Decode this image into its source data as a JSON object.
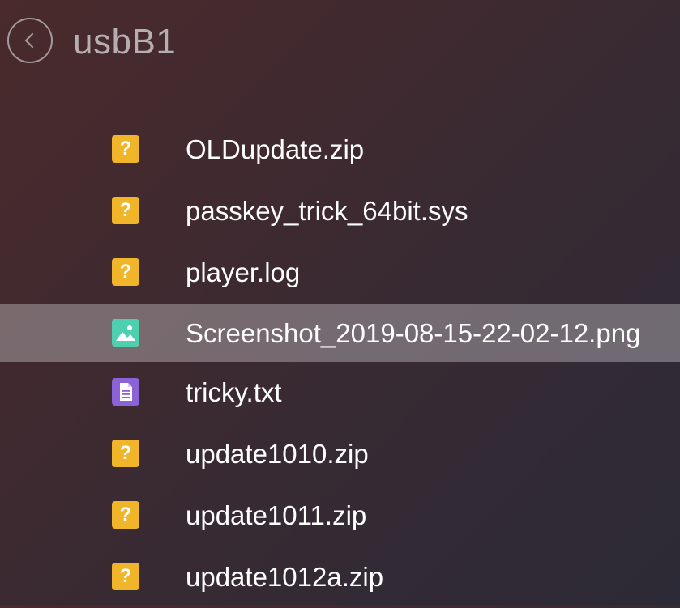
{
  "header": {
    "title": "usbB1",
    "back_icon": "chevron-left-icon"
  },
  "colors": {
    "unknown_icon": "#f1b52a",
    "image_icon": "#4ed0b0",
    "text_icon": "#8c63d6",
    "selected_row": "rgba(200,195,200,0.42)"
  },
  "files": [
    {
      "name": "OLDupdate.zip",
      "icon": "unknown-file-icon",
      "glyph": "?",
      "selected": false
    },
    {
      "name": "passkey_trick_64bit.sys",
      "icon": "unknown-file-icon",
      "glyph": "?",
      "selected": false
    },
    {
      "name": "player.log",
      "icon": "unknown-file-icon",
      "glyph": "?",
      "selected": false
    },
    {
      "name": "Screenshot_2019-08-15-22-02-12.png",
      "icon": "image-file-icon",
      "glyph": "",
      "selected": true
    },
    {
      "name": "tricky.txt",
      "icon": "text-file-icon",
      "glyph": "",
      "selected": false
    },
    {
      "name": "update1010.zip",
      "icon": "unknown-file-icon",
      "glyph": "?",
      "selected": false
    },
    {
      "name": "update1011.zip",
      "icon": "unknown-file-icon",
      "glyph": "?",
      "selected": false
    },
    {
      "name": "update1012a.zip",
      "icon": "unknown-file-icon",
      "glyph": "?",
      "selected": false
    }
  ]
}
